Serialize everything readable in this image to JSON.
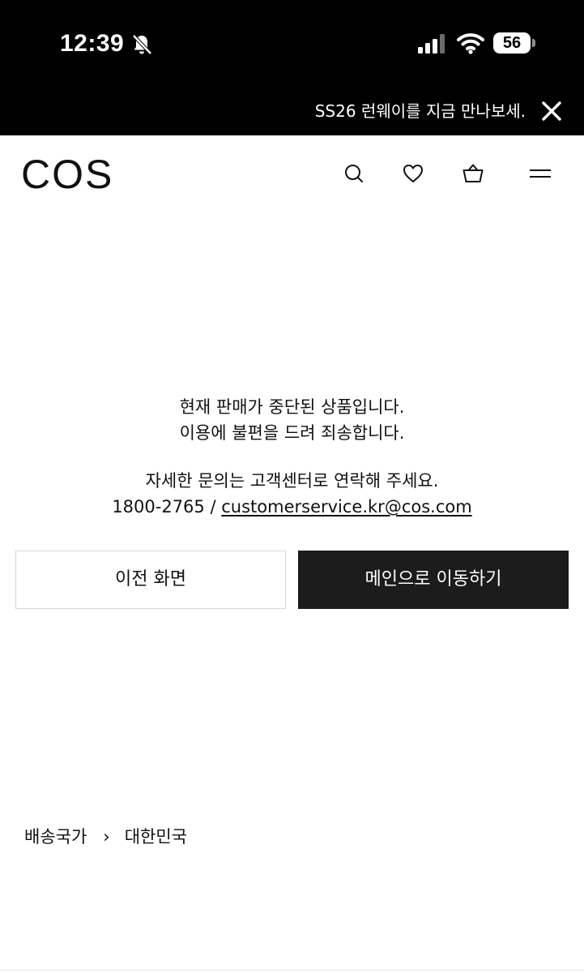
{
  "status_bar": {
    "time": "12:39",
    "battery_level": "56",
    "icons": [
      "bell-slash-icon",
      "cellular-signal-icon",
      "wifi-icon",
      "battery-icon"
    ]
  },
  "promo_banner": {
    "text": "SS26 런웨이를 지금 만나보세.",
    "close_icon": "close-icon"
  },
  "header": {
    "logo": "COS",
    "icons": [
      "search-icon",
      "heart-icon",
      "basket-icon",
      "menu-icon"
    ]
  },
  "message": {
    "line1": "현재 판매가 중단된 상품입니다.",
    "line2": "이용에 불편을 드려 죄송합니다.",
    "contact_line": "자세한 문의는 고객센터로 연락해 주세요.",
    "phone": "1800-2765",
    "separator": "/",
    "email": "customerservice.kr@cos.com"
  },
  "buttons": {
    "previous_label": "이전 화면",
    "main_label": "메인으로 이동하기"
  },
  "shipping": {
    "label": "배송국가",
    "separator": "›",
    "country": "대한민국"
  },
  "colors": {
    "black": "#000000",
    "dark_button": "#1c1c1c",
    "border": "#d8d8d8",
    "text": "#111111"
  }
}
